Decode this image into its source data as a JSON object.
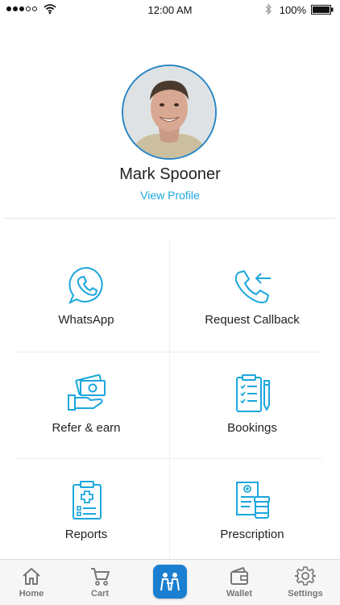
{
  "status_bar": {
    "time": "12:00 AM",
    "battery": "100%",
    "signal_bars_filled": 3,
    "signal_bars_total": 5,
    "icons": [
      "signal-icon",
      "wifi-icon",
      "bluetooth-icon",
      "battery-icon"
    ]
  },
  "profile": {
    "name": "Mark Spooner",
    "link": "View Profile",
    "avatar_icon": "user-photo"
  },
  "menu": [
    {
      "label": "WhatsApp",
      "icon": "whatsapp-icon"
    },
    {
      "label": "Request Callback",
      "icon": "phone-callback-icon"
    },
    {
      "label": "Refer & earn",
      "icon": "money-hand-icon"
    },
    {
      "label": "Bookings",
      "icon": "clipboard-pencil-icon"
    },
    {
      "label": "Reports",
      "icon": "medical-report-icon"
    },
    {
      "label": "Prescription",
      "icon": "prescription-icon"
    }
  ],
  "tab_bar": {
    "items": [
      {
        "label": "Home",
        "icon": "home-icon"
      },
      {
        "label": "Cart",
        "icon": "cart-icon"
      },
      {
        "label": "Wallet",
        "icon": "wallet-icon"
      },
      {
        "label": "Settings",
        "icon": "gear-icon"
      }
    ],
    "center_button_icon": "people-icon"
  },
  "colors": {
    "accent": "#1ba7dc",
    "avatar_ring": "#2a86c6",
    "center_button": "#1a7fd0",
    "tab_label": "#777777"
  }
}
